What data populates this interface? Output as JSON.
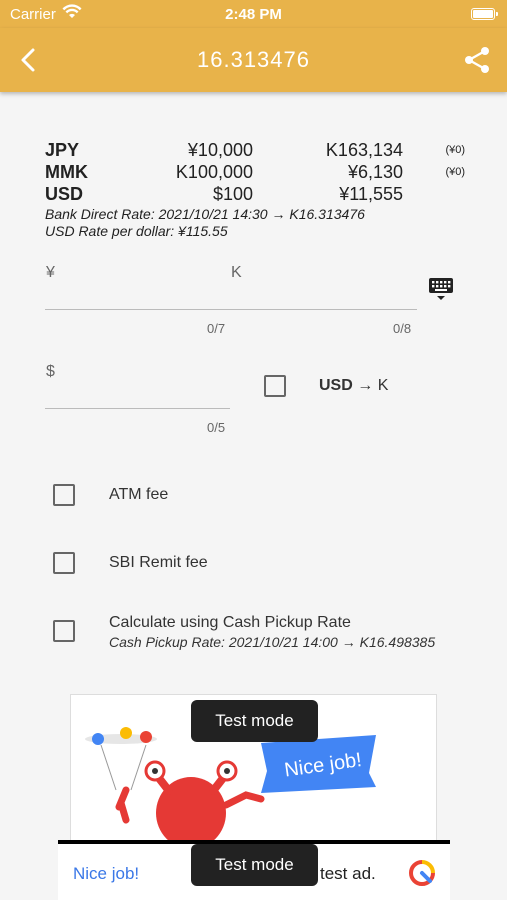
{
  "status_bar": {
    "carrier": "Carrier",
    "time": "2:48 PM"
  },
  "app_bar": {
    "title": "16.313476",
    "back_icon": "chevron-left-icon",
    "share_icon": "share-icon"
  },
  "rates": [
    {
      "currency": "JPY",
      "amount": "¥10,000",
      "converted": "K163,134",
      "fee": "(¥0)"
    },
    {
      "currency": "MMK",
      "amount": "K100,000",
      "converted": "¥6,130",
      "fee": "(¥0)"
    },
    {
      "currency": "USD",
      "amount": "$100",
      "converted": "¥11,555",
      "fee": ""
    }
  ],
  "rate_notes": {
    "bank_direct": "Bank Direct Rate: 2021/10/21 14:30 → K16.313476",
    "usd_rate": "USD Rate per dollar: ¥115.55"
  },
  "yen_input": {
    "label": "¥",
    "counter": "0/7"
  },
  "kyat_input": {
    "label": "K",
    "counter": "0/8"
  },
  "keyboard_icon": "keyboard-icon",
  "usd_input": {
    "label": "$",
    "counter": "0/5"
  },
  "usd_toggle": {
    "from": "USD",
    "arrow": "→",
    "to": "K"
  },
  "options": {
    "atm_fee": "ATM fee",
    "sbi_remit_fee": "SBI Remit fee",
    "cash_pickup": "Calculate using Cash Pickup Rate",
    "cash_pickup_rate": "Cash Pickup Rate: 2021/10/21 14:00 → K16.498385"
  },
  "ad_banner": {
    "toast": "Test mode",
    "flag_text": "Nice job!"
  },
  "bottom_ad": {
    "headline": "Nice job!",
    "toast": "Test mode",
    "description": "test ad."
  },
  "colors": {
    "accent": "#e8b34a",
    "ad_blue": "#3b78e7",
    "monster_red": "#e53935"
  }
}
